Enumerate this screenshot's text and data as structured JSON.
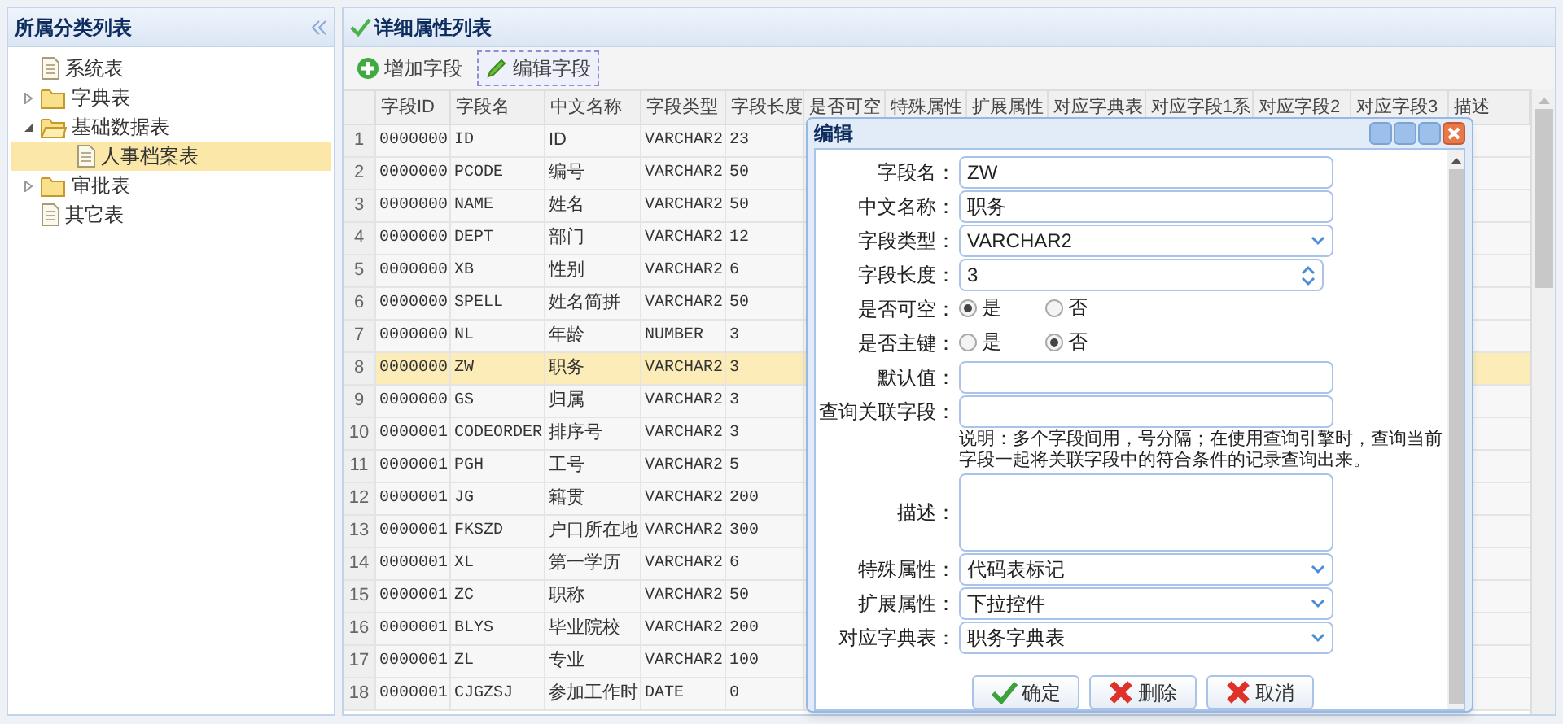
{
  "sidebar": {
    "title": "所属分类列表",
    "items": [
      {
        "label": "系统表",
        "kind": "file",
        "selected": false
      },
      {
        "label": "字典表",
        "kind": "folder",
        "expanded": false,
        "selected": false
      },
      {
        "label": "基础数据表",
        "kind": "folder",
        "expanded": true,
        "selected": false,
        "children": [
          {
            "label": "人事档案表",
            "kind": "file",
            "selected": true
          }
        ]
      },
      {
        "label": "审批表",
        "kind": "folder",
        "expanded": false,
        "selected": false
      },
      {
        "label": "其它表",
        "kind": "file",
        "selected": false
      }
    ]
  },
  "main": {
    "title": "详细属性列表",
    "toolbar": [
      {
        "label": "增加字段",
        "kind": "add",
        "selected": false
      },
      {
        "label": "编辑字段",
        "kind": "edit",
        "selected": true
      }
    ]
  },
  "table": {
    "columns": [
      "",
      "字段ID",
      "字段名",
      "中文名称",
      "字段类型",
      "字段长度",
      "是否可空",
      "特殊属性",
      "扩展属性",
      "对应字典表",
      "对应字段1系",
      "对应字段2",
      "对应字段3",
      "描述"
    ],
    "rows": [
      {
        "cells": [
          "1",
          "0000000",
          "ID",
          "ID",
          "VARCHAR2",
          "23"
        ],
        "selected": false
      },
      {
        "cells": [
          "2",
          "0000000",
          "PCODE",
          "编号",
          "VARCHAR2",
          "50"
        ],
        "selected": false
      },
      {
        "cells": [
          "3",
          "0000000",
          "NAME",
          "姓名",
          "VARCHAR2",
          "50"
        ],
        "selected": false
      },
      {
        "cells": [
          "4",
          "0000000",
          "DEPT",
          "部门",
          "VARCHAR2",
          "12"
        ],
        "selected": false
      },
      {
        "cells": [
          "5",
          "0000000",
          "XB",
          "性别",
          "VARCHAR2",
          "6"
        ],
        "selected": false
      },
      {
        "cells": [
          "6",
          "0000000",
          "SPELL",
          "姓名简拼",
          "VARCHAR2",
          "50"
        ],
        "selected": false
      },
      {
        "cells": [
          "7",
          "0000000",
          "NL",
          "年龄",
          "NUMBER",
          "3"
        ],
        "selected": false
      },
      {
        "cells": [
          "8",
          "0000000",
          "ZW",
          "职务",
          "VARCHAR2",
          "3"
        ],
        "selected": true
      },
      {
        "cells": [
          "9",
          "0000000",
          "GS",
          "归属",
          "VARCHAR2",
          "3"
        ],
        "selected": false
      },
      {
        "cells": [
          "10",
          "0000001",
          "CODEORDER",
          "排序号",
          "VARCHAR2",
          "3"
        ],
        "selected": false
      },
      {
        "cells": [
          "11",
          "0000001",
          "PGH",
          "工号",
          "VARCHAR2",
          "5"
        ],
        "selected": false
      },
      {
        "cells": [
          "12",
          "0000001",
          "JG",
          "籍贯",
          "VARCHAR2",
          "200"
        ],
        "selected": false
      },
      {
        "cells": [
          "13",
          "0000001",
          "FKSZD",
          "户口所在地",
          "VARCHAR2",
          "300"
        ],
        "selected": false
      },
      {
        "cells": [
          "14",
          "0000001",
          "XL",
          "第一学历",
          "VARCHAR2",
          "6"
        ],
        "selected": false
      },
      {
        "cells": [
          "15",
          "0000001",
          "ZC",
          "职称",
          "VARCHAR2",
          "50"
        ],
        "selected": false
      },
      {
        "cells": [
          "16",
          "0000001",
          "BLYS",
          "毕业院校",
          "VARCHAR2",
          "200"
        ],
        "selected": false
      },
      {
        "cells": [
          "17",
          "0000001",
          "ZL",
          "专业",
          "VARCHAR2",
          "100"
        ],
        "selected": false
      },
      {
        "cells": [
          "18",
          "0000001",
          "CJGZSJ",
          "参加工作时",
          "DATE",
          "0"
        ],
        "selected": false
      }
    ]
  },
  "dialog": {
    "title": "编辑",
    "fields": [
      {
        "kind": "text",
        "label": "字段名：",
        "value": "ZW"
      },
      {
        "kind": "text",
        "label": "中文名称：",
        "value": "职务"
      },
      {
        "kind": "select",
        "label": "字段类型：",
        "value": "VARCHAR2"
      },
      {
        "kind": "spinner",
        "label": "字段长度：",
        "value": "3"
      },
      {
        "kind": "radio",
        "label": "是否可空：",
        "options": [
          {
            "label": "是",
            "selected": true
          },
          {
            "label": "否",
            "selected": false
          }
        ]
      },
      {
        "kind": "radio",
        "label": "是否主键：",
        "options": [
          {
            "label": "是",
            "selected": false
          },
          {
            "label": "否",
            "selected": true
          }
        ]
      },
      {
        "kind": "text",
        "label": "默认值："
      },
      {
        "kind": "text",
        "label": "查询关联字段：",
        "note": "说明：多个字段间用，号分隔；在使用查询引擎时，查询当前字段一起将关联字段中的符合条件的记录查询出来。"
      },
      {
        "kind": "textarea",
        "label": "描述："
      },
      {
        "kind": "select",
        "label": "特殊属性：",
        "value": "代码表标记"
      },
      {
        "kind": "select",
        "label": "扩展属性：",
        "value": "下拉控件"
      },
      {
        "kind": "select",
        "label": "对应字典表：",
        "value": "职务字典表"
      }
    ],
    "buttons": [
      {
        "label": "确定",
        "kind": "ok"
      },
      {
        "label": "删除",
        "kind": "delete"
      },
      {
        "label": "取消",
        "kind": "cancel"
      }
    ]
  }
}
